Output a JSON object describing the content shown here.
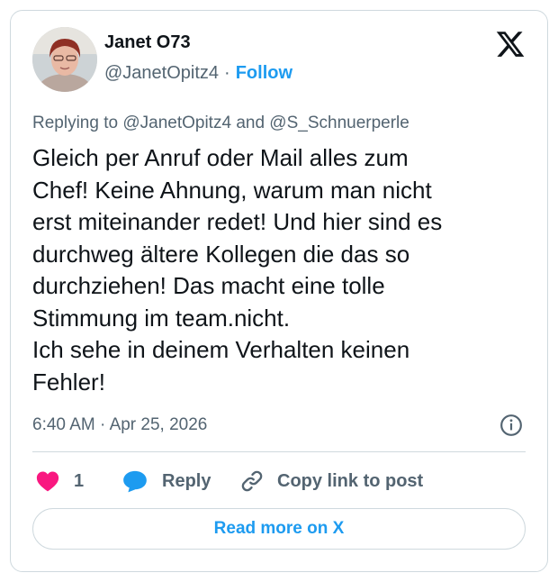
{
  "author": {
    "display_name": "Janet O73",
    "handle": "@JanetOpitz4",
    "separator": "·",
    "follow_label": "Follow"
  },
  "reply_context": {
    "prefix": "Replying to",
    "mention_1": "@JanetOpitz4",
    "conjunction": "and",
    "mention_2": "@S_Schnuerperle"
  },
  "tweet": {
    "text": "Gleich per Anruf oder Mail alles zum\nChef! Keine Ahnung, warum man nicht\nerst miteinander redet! Und hier sind es\ndurchweg ältere Kollegen die das so\ndurchziehen! Das macht eine tolle\nStimmung im team.nicht.\nIch sehe in deinem Verhalten keinen\nFehler!",
    "time": "6:40 AM",
    "separator": "·",
    "date": "Apr 25, 2026"
  },
  "actions": {
    "like_count": "1",
    "reply_label": "Reply",
    "copy_label": "Copy link to post"
  },
  "read_more_label": "Read more on X",
  "colors": {
    "accent": "#1d9bf0",
    "like": "#f91880",
    "text": "#0f1419",
    "muted": "#536471",
    "border": "#cfd9de"
  },
  "icons": [
    "x-logo-icon",
    "info-icon",
    "heart-icon",
    "reply-bubble-icon",
    "link-icon"
  ]
}
